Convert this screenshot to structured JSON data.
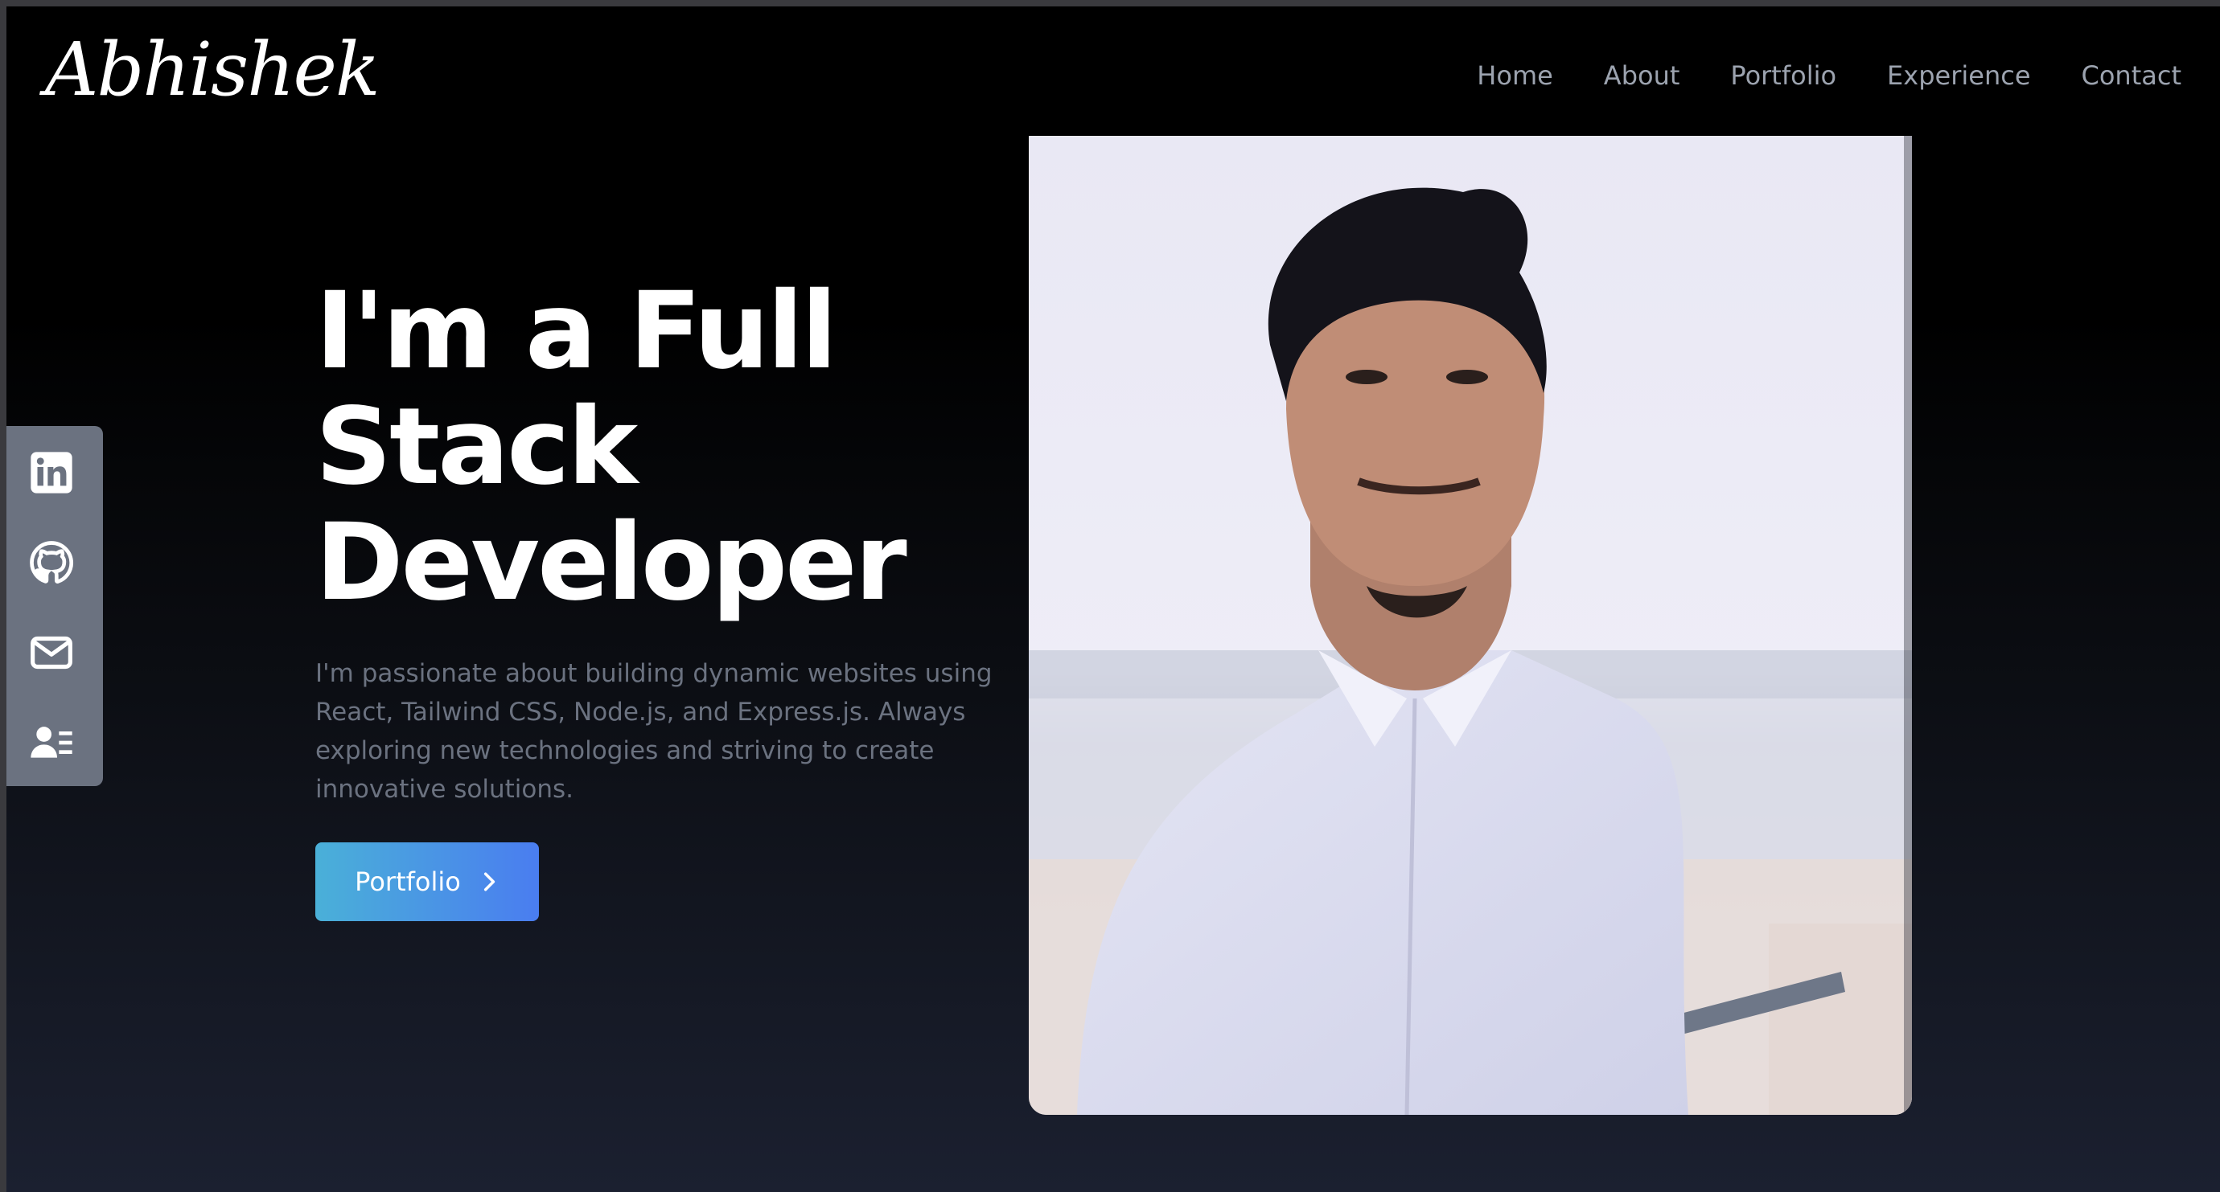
{
  "header": {
    "logo_text": "Abhishek",
    "nav": [
      {
        "label": "Home"
      },
      {
        "label": "About"
      },
      {
        "label": "Portfolio"
      },
      {
        "label": "Experience"
      },
      {
        "label": "Contact"
      }
    ]
  },
  "social": [
    {
      "icon": "linkedin-icon"
    },
    {
      "icon": "github-icon"
    },
    {
      "icon": "mail-icon"
    },
    {
      "icon": "resume-icon"
    }
  ],
  "hero": {
    "title": "I'm a Full Stack Developer",
    "description": "I'm passionate about building dynamic websites using React, Tailwind CSS, Node.js, and Express.js. Always exploring new technologies and striving to create innovative solutions.",
    "button_label": "Portfolio",
    "button_icon": "chevron-right-icon"
  },
  "colors": {
    "nav_text": "#9ca3af",
    "sidebar": "#6b7280",
    "button_gradient_start": "#4ab0d8",
    "button_gradient_end": "#4a7df0"
  }
}
